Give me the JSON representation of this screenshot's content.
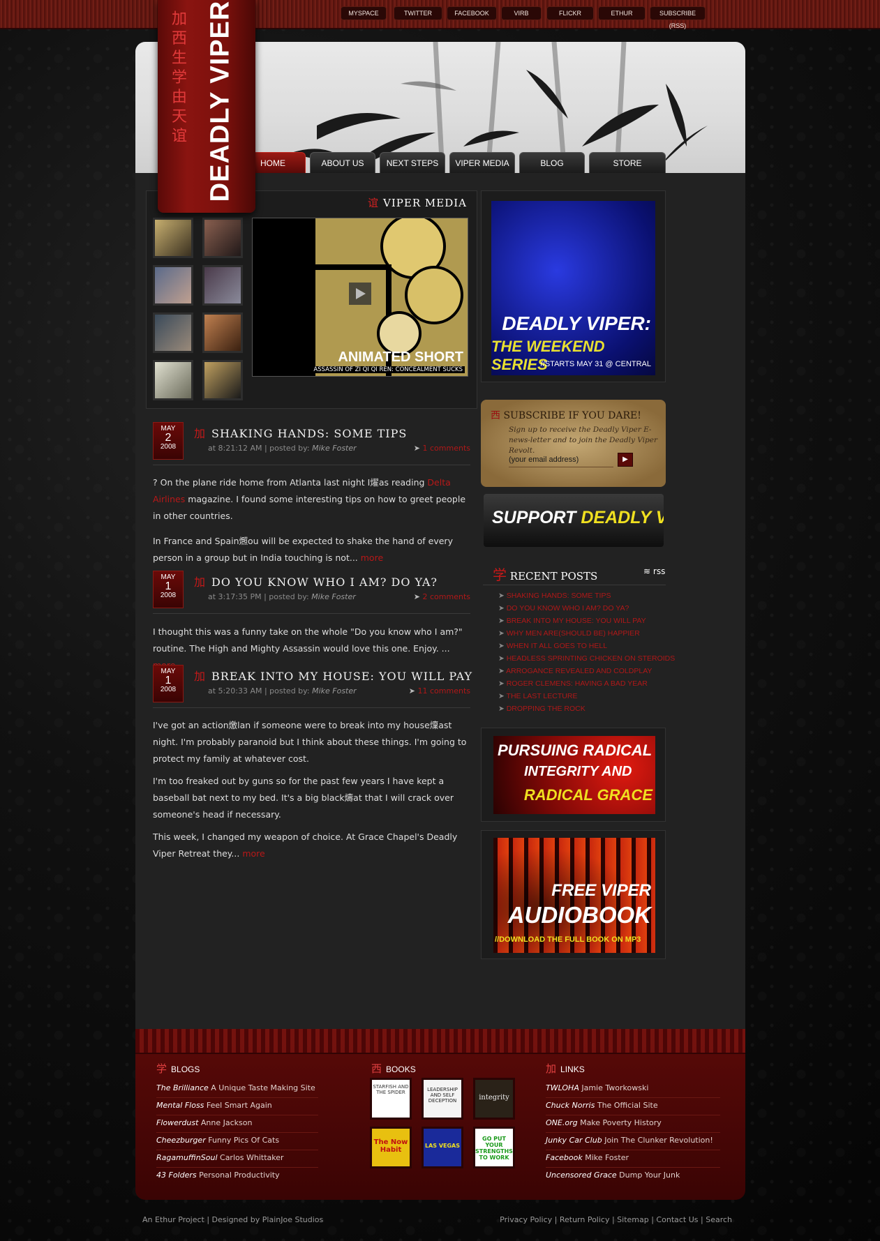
{
  "social": [
    "MYSPACE",
    "TWITTER",
    "FACEBOOK",
    "VIRB",
    "FLICKR",
    "ETHUR",
    "SUBSCRIBE (RSS)"
  ],
  "logo": {
    "chinese": "加西生学由天谊",
    "name": "DEADLY VIPER"
  },
  "nav": [
    "HOME",
    "ABOUT US",
    "NEXT STEPS",
    "VIPER MEDIA",
    "BLOG",
    "STORE"
  ],
  "viper_media": {
    "cn": "谊",
    "title": "VIPER MEDIA",
    "video_title": "ANIMATED SHORT",
    "video_caption": "ASSASSIN OF ZI QI QI REN: CONCEALMENT SUCKS"
  },
  "posts": [
    {
      "month": "MAY",
      "day": "2",
      "year": "2008",
      "cn": "加",
      "title": "SHAKING HANDS: SOME TIPS",
      "time": "at 8:21:12 AM | posted by:",
      "author": "Mike Foster",
      "comments": "1 comments",
      "p1a": "? On the plane ride home from Atlanta last night I燿as reading ",
      "p1link": "Delta Airlines",
      "p1b": " magazine. I found some interesting tips on how to greet people in other countries.",
      "p2": "In France and Spain燳ou will be expected to shake the hand of every person in a group but in India touching is not... ",
      "more": "more"
    },
    {
      "month": "MAY",
      "day": "1",
      "year": "2008",
      "cn": "加",
      "title": "DO YOU KNOW WHO I AM? DO YA?",
      "time": "at 3:17:35 PM | posted by:",
      "author": "Mike Foster",
      "comments": "2 comments",
      "p1": "I thought this was a funny take on the whole \"Do you know who I am?\" routine. The High and Mighty Assassin would love this one. Enjoy. ... ",
      "more": "more"
    },
    {
      "month": "MAY",
      "day": "1",
      "year": "2008",
      "cn": "加",
      "title": "BREAK INTO MY HOUSE: YOU WILL PAY",
      "time": "at 5:20:33 AM | posted by:",
      "author": "Mike Foster",
      "comments": "11 comments",
      "p1": "I've got an action燩lan if someone were to break into my house燣ast night. I'm probably paranoid but I think about these things. I'm going to protect my family at whatever cost.",
      "p2": "I'm too freaked out by guns so for the past few years I have kept a baseball bat next to my bed. It's a big black燽at that I will crack over someone's head if necessary.",
      "p3": "This week, I changed my weapon of choice. At Grace Chapel's Deadly Viper Retreat they... ",
      "more": "more"
    }
  ],
  "weekend_ad": {
    "line1": "DEADLY VIPER:",
    "line2": "THE WEEKEND SERIES",
    "line3": "//STARTS MAY 31 @ CENTRAL"
  },
  "subscribe": {
    "cn": "西",
    "title": "SUBSCRIBE IF YOU DARE!",
    "text": "Sign up to receive the Deadly Viper E-news-letter and to join the Deadly Viper Revolt.",
    "placeholder": "(your email address)"
  },
  "support": {
    "a": "SUPPORT ",
    "b": "DEADLY VIPER"
  },
  "recent": {
    "cn": "学",
    "title": "RECENT POSTS",
    "rss": "rss",
    "items": [
      "SHAKING HANDS: SOME TIPS",
      "DO YOU KNOW WHO I AM? DO YA?",
      "BREAK INTO MY HOUSE: YOU WILL PAY",
      "WHY MEN ARE(SHOULD BE) HAPPIER",
      "WHEN IT ALL GOES TO HELL",
      "HEADLESS SPRINTING CHICKEN ON STEROIDS",
      "ARROGANCE REVEALED AND COLDPLAY",
      "ROGER CLEMENS: HAVING A BAD YEAR",
      "THE LAST LECTURE",
      "DROPPING THE ROCK"
    ]
  },
  "integrity_ad": {
    "l1": "PURSUING RADICAL",
    "l2": "INTEGRITY AND",
    "l3": "RADICAL GRACE"
  },
  "audiobook_ad": {
    "l1": "FREE VIPER",
    "l2": "AUDIOBOOK",
    "l3": "//DOWNLOAD THE FULL BOOK ON MP3"
  },
  "footer": {
    "blogs": {
      "cn": "学",
      "title": "BLOGS",
      "items": [
        [
          "The Brilliance",
          "A Unique Taste Making Site"
        ],
        [
          "Mental Floss",
          "Feel Smart Again"
        ],
        [
          "Flowerdust",
          "Anne Jackson"
        ],
        [
          "Cheezburger",
          "Funny Pics Of Cats"
        ],
        [
          "RagamuffinSoul",
          "Carlos Whittaker"
        ],
        [
          "43 Folders",
          "Personal Productivity"
        ]
      ]
    },
    "books": {
      "cn": "西",
      "title": "BOOKS",
      "items": [
        "STARFISH AND THE SPIDER",
        "LEADERSHIP AND SELF DECEPTION",
        "integrity",
        "The Now Habit",
        "LAS VEGAS",
        "GO PUT YOUR STRENGTHS TO WORK"
      ]
    },
    "links": {
      "cn": "加",
      "title": "LINKS",
      "items": [
        [
          "TWLOHA",
          "Jamie Tworkowski"
        ],
        [
          "Chuck Norris",
          "The Official Site"
        ],
        [
          "ONE.org",
          "Make Poverty History"
        ],
        [
          "Junky Car Club",
          "Join The Clunker Revolution!"
        ],
        [
          "Facebook",
          "Mike Foster"
        ],
        [
          "Uncensored Grace",
          "Dump Your Junk"
        ]
      ]
    }
  },
  "bottom": {
    "left": "An Ethur Project | Designed by PlainJoe Studios",
    "right": "Privacy Policy | Return Policy | Sitemap | Contact Us | Search"
  }
}
